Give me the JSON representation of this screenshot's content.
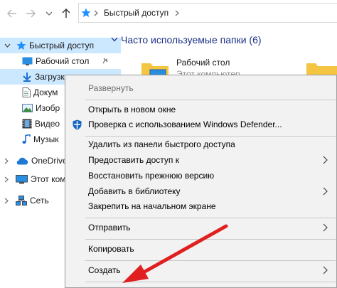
{
  "address": {
    "path_label": "Быстрый доступ"
  },
  "nav": {
    "quick_access": "Быстрый доступ",
    "items": [
      {
        "label": "Рабочий стол"
      },
      {
        "label": "Загрузки"
      },
      {
        "label": "Докум"
      },
      {
        "label": "Изобр"
      },
      {
        "label": "Видео"
      },
      {
        "label": "Музык"
      }
    ],
    "onedrive": "OneDrive",
    "this_pc": "Этот ком",
    "network": "Сеть"
  },
  "content": {
    "section_title": "Часто используемые папки (6)",
    "folder": {
      "name": "Рабочий стол",
      "location": "Этот компьютер"
    }
  },
  "context_menu": {
    "items": [
      {
        "label": "Развернуть",
        "disabled": true
      },
      {
        "label": "Открыть в новом окне"
      },
      {
        "label": "Проверка с использованием Windows Defender..."
      },
      {
        "label": "Удалить из панели быстрого доступа"
      },
      {
        "label": "Предоставить доступ к",
        "submenu": true
      },
      {
        "label": "Восстановить прежнюю версию"
      },
      {
        "label": "Добавить в библиотеку",
        "submenu": true
      },
      {
        "label": "Закрепить на начальном экране"
      },
      {
        "label": "Отправить",
        "submenu": true
      },
      {
        "label": "Копировать"
      },
      {
        "label": "Создать",
        "submenu": true
      }
    ]
  },
  "colors": {
    "accent": "#1e90ff",
    "selection": "#cce8ff",
    "folder": "#f4c542",
    "arrow": "#e02020",
    "defender": "#1565c0"
  }
}
